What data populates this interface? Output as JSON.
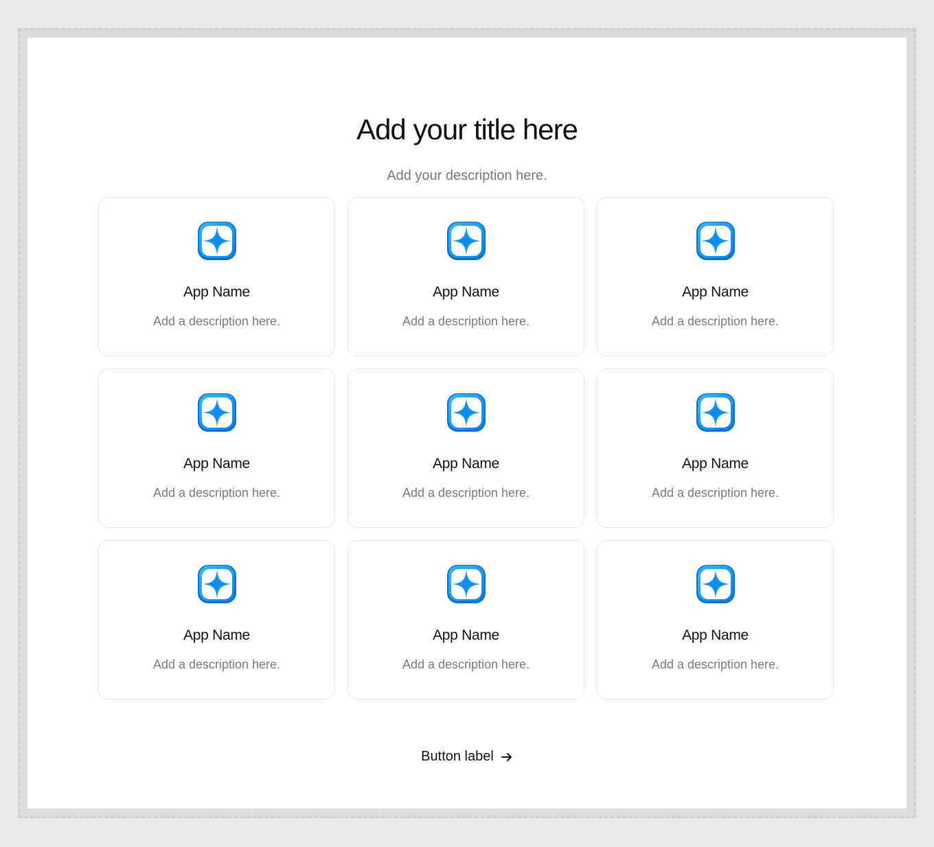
{
  "header": {
    "title": "Add your title here",
    "description": "Add your description here."
  },
  "colors": {
    "accent": "#1a9af5",
    "accent_dark": "#0b6fd6"
  },
  "cards": [
    {
      "icon": "app-star-icon",
      "name": "App Name",
      "description": "Add a description here."
    },
    {
      "icon": "app-star-icon",
      "name": "App Name",
      "description": "Add a description here."
    },
    {
      "icon": "app-star-icon",
      "name": "App Name",
      "description": "Add a description here."
    },
    {
      "icon": "app-star-icon",
      "name": "App Name",
      "description": "Add a description here."
    },
    {
      "icon": "app-star-icon",
      "name": "App Name",
      "description": "Add a description here."
    },
    {
      "icon": "app-star-icon",
      "name": "App Name",
      "description": "Add a description here."
    },
    {
      "icon": "app-star-icon",
      "name": "App Name",
      "description": "Add a description here."
    },
    {
      "icon": "app-star-icon",
      "name": "App Name",
      "description": "Add a description here."
    },
    {
      "icon": "app-star-icon",
      "name": "App Name",
      "description": "Add a description here."
    }
  ],
  "cta": {
    "label": "Button label",
    "icon": "arrow-right-icon"
  }
}
